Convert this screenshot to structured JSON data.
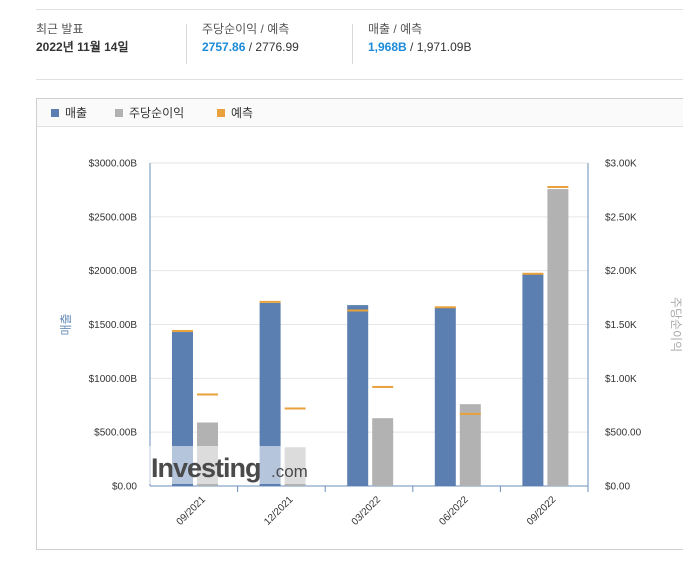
{
  "summary": {
    "latest": {
      "label": "최근 발표",
      "date": "2022년 11월 14일"
    },
    "eps": {
      "label": "주당순이익 / 예측",
      "actual": "2757.86",
      "forecast": "2776.99"
    },
    "revenue": {
      "label": "매출 / 예측",
      "actual": "1,968B",
      "forecast": "1,971.09B"
    },
    "separator": "/"
  },
  "legend": {
    "revenue": "매출",
    "eps": "주당순이익",
    "forecast": "예측"
  },
  "colors": {
    "revenue": "#5b7fb0",
    "eps": "#b2b2b2",
    "forecast": "#e9a23b",
    "axis": "#6a8fb8",
    "highlight": "#1a8ad9"
  },
  "watermark": {
    "brand": "Investing",
    "suffix": ".com"
  },
  "chart_data": {
    "type": "bar",
    "categories": [
      "09/2021",
      "12/2021",
      "03/2022",
      "06/2022",
      "09/2022"
    ],
    "series": [
      {
        "name": "매출",
        "axis": "left",
        "values": [
          1430,
          1700,
          1680,
          1660,
          1968
        ]
      },
      {
        "name": "주당순이익",
        "axis": "right",
        "values": [
          590,
          360,
          630,
          760,
          2757.86
        ]
      }
    ],
    "forecasts": {
      "name": "예측",
      "revenue": [
        1440,
        1710,
        1630,
        1660,
        1971.09
      ],
      "eps": [
        850,
        720,
        920,
        670,
        2776.99
      ]
    },
    "ylabel_left": "매출",
    "ylabel_right": "주당순이익",
    "ylim_left": [
      0,
      3000
    ],
    "ylim_right": [
      0,
      3000
    ],
    "yticks_left": [
      "$0.00",
      "$500.00B",
      "$1000.00B",
      "$1500.00B",
      "$2000.00B",
      "$2500.00B",
      "$3000.00B"
    ],
    "yticks_right": [
      "$0.00",
      "$500.00",
      "$1.00K",
      "$1.50K",
      "$2.00K",
      "$2.50K",
      "$3.00K"
    ],
    "legend_position": "top-left",
    "grid": true
  }
}
